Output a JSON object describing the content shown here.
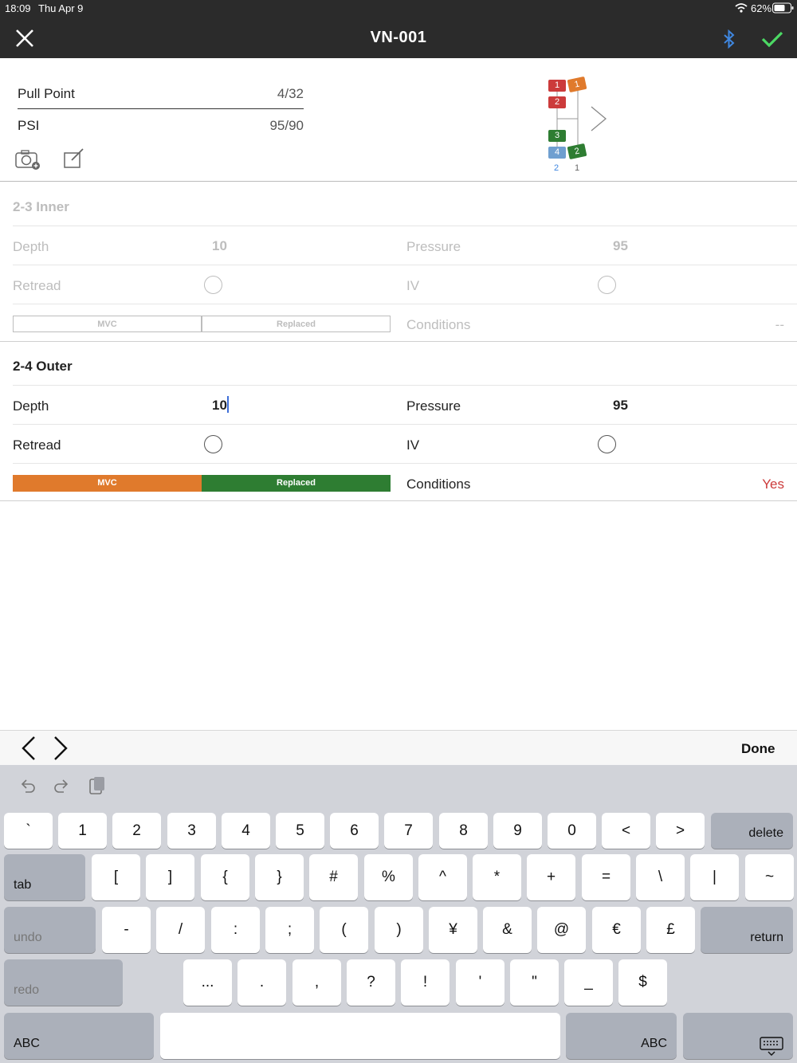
{
  "status_bar": {
    "time": "18:09",
    "date": "Thu Apr 9",
    "battery": "62%"
  },
  "nav": {
    "title": "VN-001"
  },
  "header": {
    "pull_point_label": "Pull Point",
    "pull_point_value": "4/32",
    "psi_label": "PSI",
    "psi_value": "95/90"
  },
  "axle_diagram": {
    "left_tires": [
      "1",
      "2",
      "3",
      "4"
    ],
    "right_tires": [
      "1",
      "2"
    ],
    "left_count": "2",
    "right_count": "1",
    "colors": {
      "red": "#cc3b3b",
      "orange": "#e07a2c",
      "green": "#2e7d32",
      "blue": "#6f9fd0"
    }
  },
  "sections": [
    {
      "title": "2-3 Inner",
      "depth_label": "Depth",
      "depth_value": "10",
      "pressure_label": "Pressure",
      "pressure_value": "95",
      "retread_label": "Retread",
      "iv_label": "IV",
      "mvc_label": "MVC",
      "replaced_label": "Replaced",
      "conditions_label": "Conditions",
      "conditions_value": "--"
    },
    {
      "title": "2-4 Outer",
      "depth_label": "Depth",
      "depth_value": "10",
      "pressure_label": "Pressure",
      "pressure_value": "95",
      "retread_label": "Retread",
      "iv_label": "IV",
      "mvc_label": "MVC",
      "replaced_label": "Replaced",
      "conditions_label": "Conditions",
      "conditions_value": "Yes"
    }
  ],
  "colors": {
    "mvc": "#e07a2c",
    "replaced": "#2e7d32",
    "conditions_yes": "#cc3b3b",
    "check": "#4cd964",
    "bluetooth": "#3f87e0"
  },
  "keyboard": {
    "done_label": "Done",
    "row1": [
      "`",
      "1",
      "2",
      "3",
      "4",
      "5",
      "6",
      "7",
      "8",
      "9",
      "0",
      "<",
      ">"
    ],
    "delete_label": "delete",
    "tab_label": "tab",
    "row2": [
      "[",
      "]",
      "{",
      "}",
      "#",
      "%",
      "^",
      "*",
      "+",
      "=",
      "\\",
      "|",
      "~"
    ],
    "undo_label": "undo",
    "row3": [
      "-",
      "/",
      ":",
      ";",
      "(",
      ")",
      "¥",
      "&",
      "@",
      "€",
      "£"
    ],
    "return_label": "return",
    "redo_label": "redo",
    "row4": [
      "...",
      ".",
      ",",
      "?",
      "!",
      "'",
      "\"",
      "_",
      "$"
    ],
    "abc_label": "ABC"
  }
}
